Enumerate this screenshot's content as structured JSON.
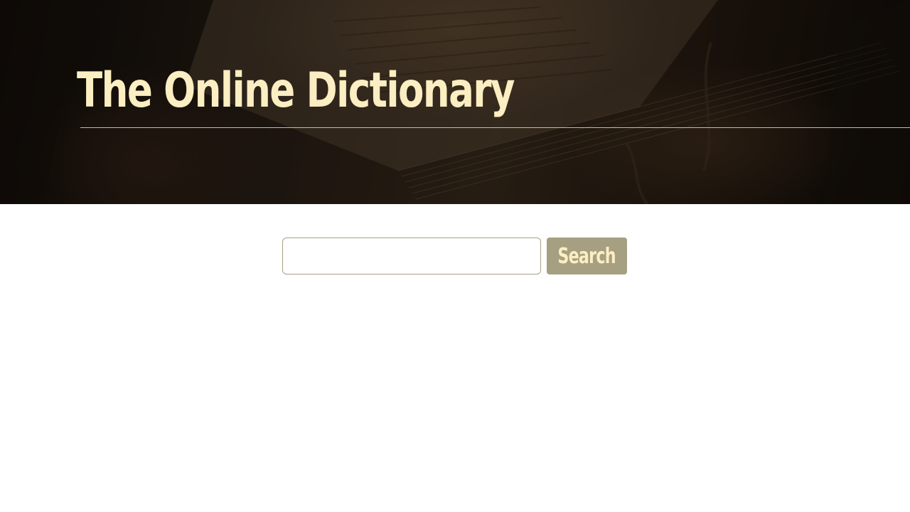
{
  "header": {
    "title": "The Online Dictionary",
    "background_image": "old-book-photo"
  },
  "search": {
    "value": "",
    "placeholder": "",
    "button_label": "Search"
  },
  "colors": {
    "title_text": "#fbeec2",
    "accent": "#a79f82",
    "input_border": "#a89f83",
    "page_background": "#ffffff"
  }
}
